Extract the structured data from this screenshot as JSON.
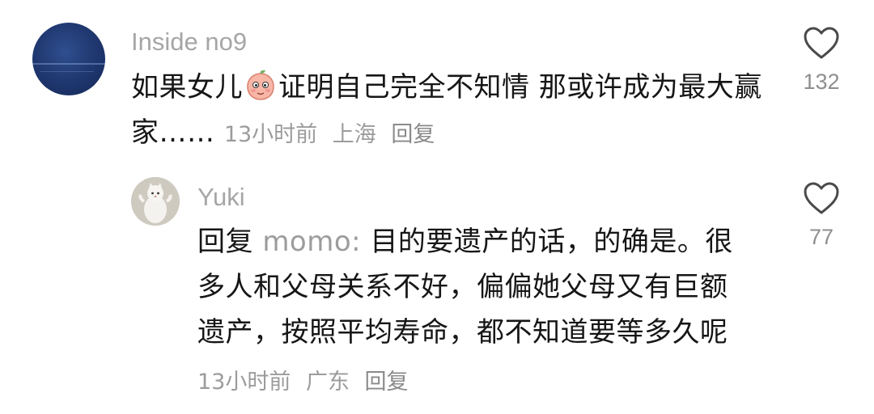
{
  "comment": {
    "username": "Inside no9",
    "text_before_emoji": "如果女儿",
    "emoji": "peach-face-emoji",
    "text_after_emoji": "证明自己完全不知情 那或许成为最大赢家……",
    "time": "13小时前",
    "location": "上海",
    "reply_label": "回复",
    "likes": "132"
  },
  "reply": {
    "username": "Yuki",
    "reply_prefix": "回复",
    "mention": "momo:",
    "text": "目的要遗产的话，的确是。很多人和父母关系不好，偏偏她父母又有巨额遗产，按照平均寿命，都不知道要等多久呢",
    "time": "13小时前",
    "location": "广东",
    "reply_label": "回复",
    "likes": "77"
  },
  "icons": {
    "like": "heart-outline-icon"
  },
  "colors": {
    "text": "#161616",
    "muted": "#a6a6a6",
    "icon": "#444444"
  }
}
